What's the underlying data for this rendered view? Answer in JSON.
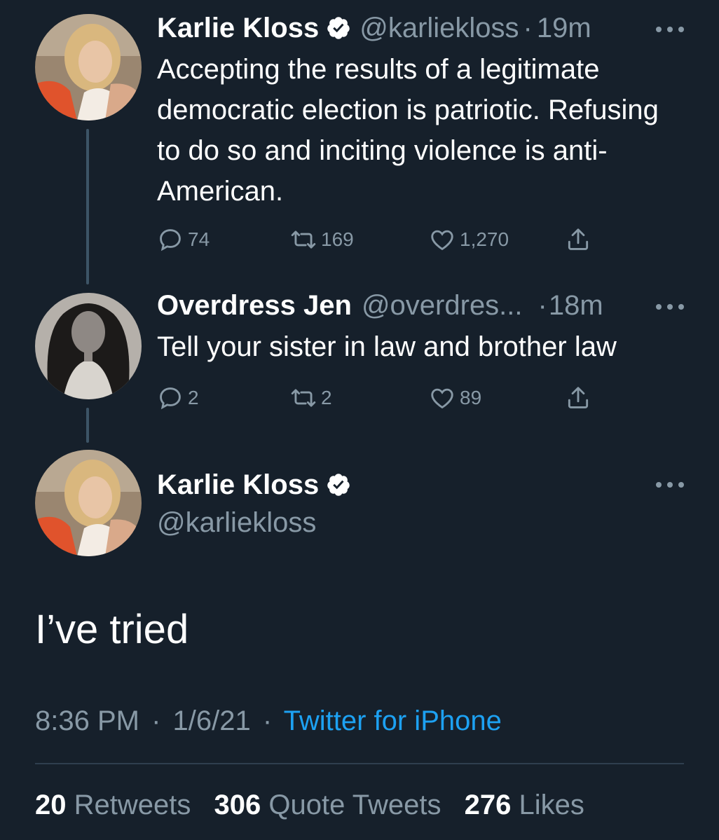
{
  "colors": {
    "background": "#16202b",
    "secondary_text": "#8899a6",
    "link": "#1da1f2",
    "thread_line": "#3d5466"
  },
  "tweet1": {
    "name": "Karlie Kloss",
    "handle": "@karliekloss",
    "separator": "·",
    "time": "19m",
    "verified_icon": "verified-badge-icon",
    "text": "Accepting the results of a legitimate democratic election is patriotic. Refusing to do so and inciting violence is anti-American.",
    "replies": "74",
    "retweets": "169",
    "likes": "1,270"
  },
  "tweet2": {
    "name": "Overdress Jen",
    "handle": "@overdres...",
    "separator": "·",
    "time": "18m",
    "text": "Tell your sister in law and brother law",
    "replies": "2",
    "retweets": "2",
    "likes": "89"
  },
  "main_tweet": {
    "name": "Karlie Kloss",
    "handle": "@karliekloss",
    "text": "I’ve tried",
    "time": "8:36 PM",
    "date": "1/6/21",
    "separator": "·",
    "source": "Twitter for iPhone",
    "retweets_count": "20",
    "retweets_label": "Retweets",
    "quotes_count": "306",
    "quotes_label": "Quote Tweets",
    "likes_count": "276",
    "likes_label": "Likes"
  }
}
